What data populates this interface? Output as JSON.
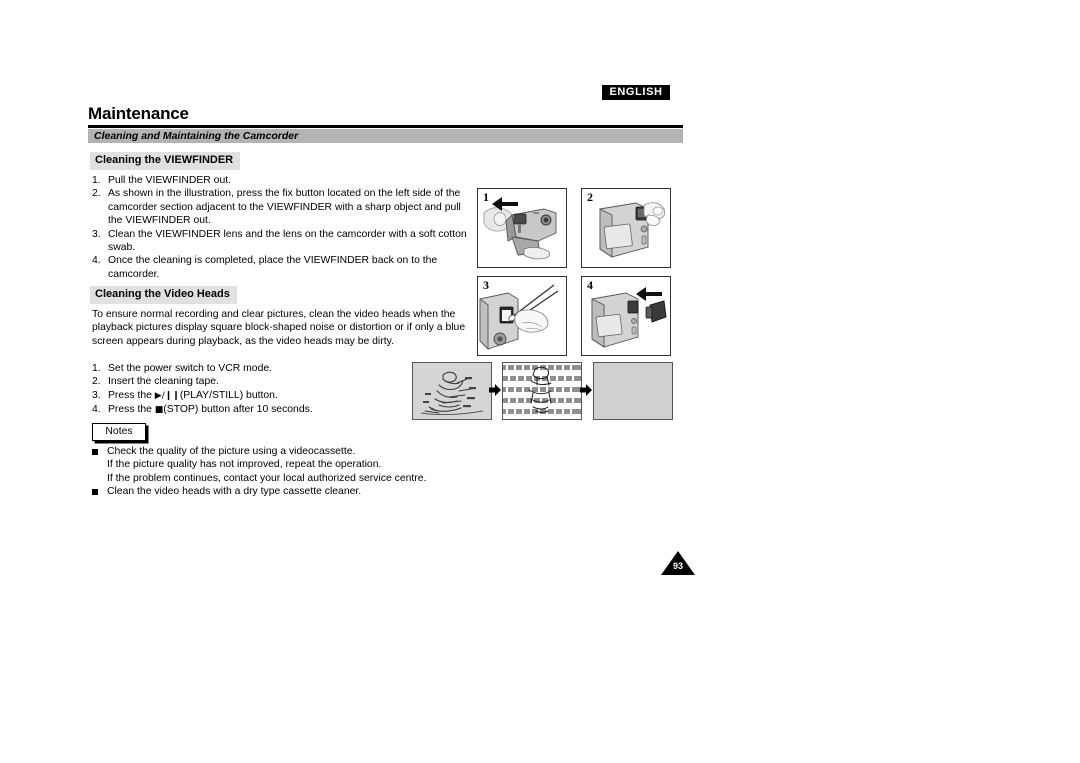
{
  "language_badge": "ENGLISH",
  "chapter_title": "Maintenance",
  "section_band": "Cleaning and Maintaining the Camcorder",
  "sections": {
    "viewfinder": {
      "heading": "Cleaning the VIEWFINDER",
      "steps": [
        {
          "num": "1.",
          "text": "Pull the VIEWFINDER out."
        },
        {
          "num": "2.",
          "text": "As shown in the illustration, press the fix button located on the left side of the camcorder section adjacent to the VIEWFINDER with a sharp object and pull the VIEWFINDER out."
        },
        {
          "num": "3.",
          "text": "Clean the VIEWFINDER lens and the lens on the camcorder with a soft cotton swab."
        },
        {
          "num": "4.",
          "text": "Once the cleaning is completed, place the VIEWFINDER back on to the camcorder."
        }
      ]
    },
    "video_heads": {
      "heading": "Cleaning the Video Heads",
      "paragraph": "To ensure normal recording and clear pictures, clean the video heads when the playback pictures display square block-shaped noise or distortion or if only a blue screen appears during playback, as the video heads may be dirty.",
      "steps": [
        {
          "num": "1.",
          "text": "Set the power switch to VCR mode.",
          "glyph": "",
          "tail": ""
        },
        {
          "num": "2.",
          "text": "Insert the cleaning tape.",
          "glyph": "",
          "tail": ""
        },
        {
          "num": "3.",
          "text": "Press the ",
          "glyph": "▶/❙❙",
          "tail": "(PLAY/STILL) button."
        },
        {
          "num": "4.",
          "text": "Press the ",
          "glyph": "■",
          "tail": "(STOP) button after 10 seconds."
        }
      ]
    }
  },
  "notes": {
    "label": "Notes",
    "items": [
      "Check the quality of the picture using a videocassette.\nIf the picture quality has not improved, repeat the operation.\nIf the problem continues, contact your local authorized service centre.",
      "Clean the video heads with a dry type cassette cleaner."
    ]
  },
  "illustrations": {
    "panels": [
      {
        "number": "1",
        "caption": "camcorder with hand pressing fix button, arrow pointing left"
      },
      {
        "number": "2",
        "caption": "hand pulling viewfinder off camcorder body"
      },
      {
        "number": "3",
        "caption": "hand cleaning viewfinder lens with cotton swab"
      },
      {
        "number": "4",
        "caption": "viewfinder being reattached to camcorder, arrow pointing left"
      }
    ],
    "sequence": [
      {
        "caption": "clear playback picture of cyclist"
      },
      {
        "caption": "playback picture with block-shaped noise bands"
      },
      {
        "caption": "blank blue screen"
      }
    ]
  },
  "page_number": "93",
  "colors": {
    "band_gray": "#b3b3b3",
    "chip_gray": "#e0e0e0",
    "badge_black": "#000000"
  }
}
